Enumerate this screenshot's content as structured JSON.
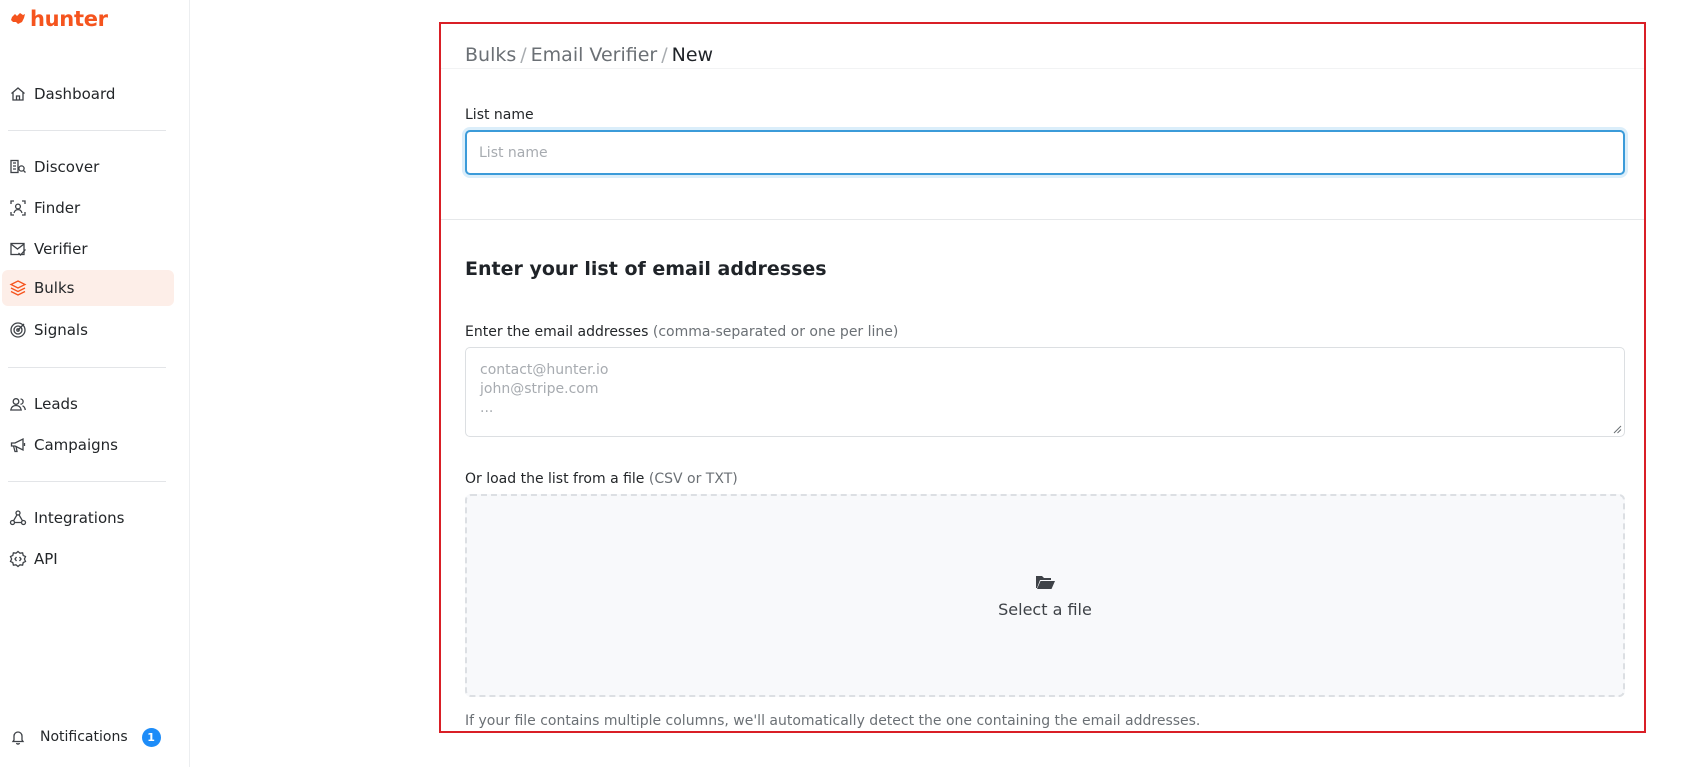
{
  "brand": {
    "name": "hunter",
    "color": "#f5541e"
  },
  "sidebar": {
    "items": [
      {
        "label": "Dashboard",
        "icon": "home-icon"
      },
      {
        "label": "Discover",
        "icon": "discover-icon"
      },
      {
        "label": "Finder",
        "icon": "finder-icon"
      },
      {
        "label": "Verifier",
        "icon": "verifier-icon"
      },
      {
        "label": "Bulks",
        "icon": "layers-icon",
        "active": true
      },
      {
        "label": "Signals",
        "icon": "signals-icon"
      },
      {
        "label": "Leads",
        "icon": "users-icon"
      },
      {
        "label": "Campaigns",
        "icon": "megaphone-icon"
      },
      {
        "label": "Integrations",
        "icon": "integrations-icon"
      },
      {
        "label": "API",
        "icon": "api-gear-icon"
      }
    ],
    "notifications": {
      "label": "Notifications",
      "count": "1",
      "icon": "bell-icon"
    }
  },
  "breadcrumb": {
    "items": [
      "Bulks",
      "Email Verifier"
    ],
    "separator": "/",
    "current": "New"
  },
  "form": {
    "list_name": {
      "label": "List name",
      "placeholder": "List name",
      "value": ""
    },
    "section_title": "Enter your list of email addresses",
    "emails": {
      "label": "Enter the email addresses",
      "hint": "(comma-separated or one per line)",
      "placeholder": "contact@hunter.io\njohn@stripe.com\n..."
    },
    "file": {
      "label": "Or load the list from a file",
      "hint": "(CSV or TXT)",
      "button_label": "Select a file",
      "icon": "folder-open-icon"
    },
    "helper_text": "If your file contains multiple columns, we'll automatically detect the one containing the email addresses."
  },
  "colors": {
    "accent": "#f5541e",
    "focus": "#3b9bd9",
    "highlight_border": "#d91f26",
    "badge": "#1d8cf8"
  }
}
